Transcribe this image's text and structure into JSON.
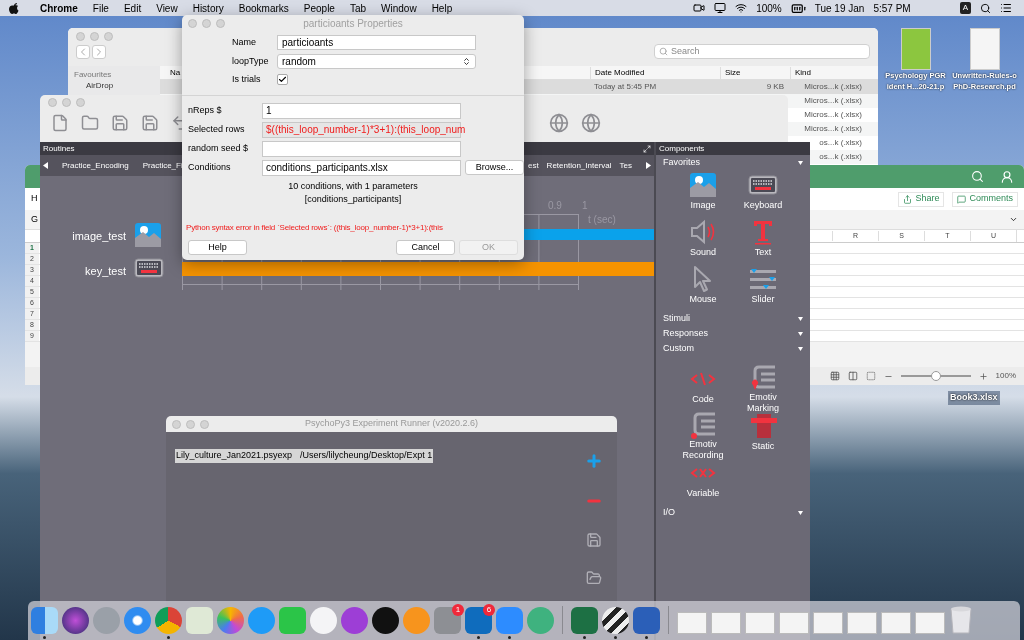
{
  "menubar": {
    "app": "Chrome",
    "items": [
      "File",
      "Edit",
      "View",
      "History",
      "Bookmarks",
      "People",
      "Tab",
      "Window",
      "Help"
    ],
    "battery": "100%",
    "date": "Tue 19 Jan",
    "time": "5:57 PM",
    "input_source": "A"
  },
  "desktop_icons": [
    {
      "lines": [
        "Psychology PGR",
        "ident H...20-21.p"
      ]
    },
    {
      "lines": [
        "Unwritten-Rules-o",
        "PhD-Research.pd"
      ]
    }
  ],
  "desktop_file_label": "Book3.xlsx",
  "finder": {
    "search_placeholder": "Search",
    "sidebar_heading": "Favourites",
    "sidebar_items": [
      "AirDrop"
    ],
    "columns": [
      "Na",
      "Date Modified",
      "Size",
      "Kind"
    ],
    "rows": [
      {
        "date": "Today at 5:45 PM",
        "size": "9 KB",
        "kind": "Micros...k (.xlsx)",
        "selected": true
      },
      {
        "kind": "Micros...k (.xlsx)",
        "selected": false
      },
      {
        "kind": "Micros...k (.xlsx)",
        "selected": false
      },
      {
        "kind": "Micros...k (.xlsx)",
        "selected": false
      },
      {
        "kind": "os...k (.xlsx)",
        "selected": false
      },
      {
        "kind": "os...k (.xlsx)",
        "selected": false
      }
    ]
  },
  "excel": {
    "ribbon_tab": "H",
    "name_box": "G",
    "buttons": [
      "Share",
      "Comments"
    ],
    "columns": [
      "R",
      "S",
      "T",
      "U"
    ],
    "rows": [
      {
        "label": "1",
        "selected": true
      },
      {
        "label": "2",
        "selected": false
      },
      {
        "label": "3",
        "selected": false
      },
      {
        "label": "4",
        "selected": false
      },
      {
        "label": "5",
        "selected": false
      },
      {
        "label": "6",
        "selected": false
      },
      {
        "label": "7",
        "selected": false
      },
      {
        "label": "8",
        "selected": false
      },
      {
        "label": "9",
        "selected": false
      }
    ],
    "zoom": "100%",
    "zoom_slider": {
      "level": 0.5
    }
  },
  "builder": {
    "routines_title": "Routines",
    "routine_tabs_left": [
      "Practice_Encoding",
      "Practice_Fi"
    ],
    "routine_tabs_right": [
      "est",
      "Retention_Interval",
      "Tes"
    ],
    "timeline": {
      "ticks": [
        "0.9",
        "1"
      ],
      "axis_label": "t (sec)",
      "components": [
        {
          "name": "image_test",
          "kind": "image",
          "color": "#0aa2eb"
        },
        {
          "name": "key_test",
          "kind": "keyboard",
          "color": "#f59300"
        }
      ]
    },
    "components_panel": {
      "title": "Components",
      "sections": [
        {
          "label": "Favorites",
          "items": [
            {
              "label": "Image",
              "kind": "image"
            },
            {
              "label": "Keyboard",
              "kind": "keyboard"
            },
            {
              "label": "Sound",
              "kind": "sound"
            },
            {
              "label": "Text",
              "kind": "text"
            },
            {
              "label": "Mouse",
              "kind": "mouse"
            },
            {
              "label": "Slider",
              "kind": "slider"
            }
          ]
        },
        {
          "label": "Stimuli"
        },
        {
          "label": "Responses"
        },
        {
          "label": "Custom",
          "items": [
            {
              "label": "Code",
              "kind": "code"
            },
            {
              "label": "Emotiv Marking",
              "kind": "emotiv_marking"
            },
            {
              "label": "Emotiv Recording",
              "kind": "emotiv_recording"
            },
            {
              "label": "Static",
              "kind": "static"
            },
            {
              "label": "Variable",
              "kind": "variable"
            }
          ]
        },
        {
          "label": "I/O"
        }
      ]
    }
  },
  "runner": {
    "title": "PsychoPy3 Experiment Runner (v2020.2.6)",
    "experiments": [
      {
        "file": "Lily_culture_Jan2021.psyexp",
        "path": "/Users/lilycheung/Desktop/Expt 1",
        "selected": true
      }
    ]
  },
  "dialog": {
    "title": "particioants Properties",
    "name": {
      "label": "Name",
      "value": "particioants"
    },
    "loop_type": {
      "label": "loopType",
      "value": "random"
    },
    "is_trials": {
      "label": "Is trials",
      "checked": true
    },
    "fields": [
      {
        "label": "nReps $",
        "value": "1",
        "error": false
      },
      {
        "label": "Selected rows",
        "value": "$((this_loop_number-1)*3+1):(this_loop_num",
        "error": true
      },
      {
        "label": "random seed $",
        "error": false
      },
      {
        "label": "Conditions",
        "value": "conditions_participants.xlsx",
        "error": false,
        "button": "Browse..."
      }
    ],
    "info": [
      "10 conditions, with 1 parameters",
      "[conditions_participants]"
    ],
    "error": "Python syntax error in field `Selected rows`:  ((this_loop_number-1)*3+1):(this",
    "buttons": [
      {
        "label": "Help",
        "disabled": false
      },
      {
        "label": "Cancel",
        "disabled": false
      },
      {
        "label": "OK",
        "disabled": true
      }
    ]
  },
  "dock": {
    "items": [
      {
        "kind": "finder",
        "running": true
      },
      {
        "kind": "siri",
        "running": false
      },
      {
        "kind": "launchpad",
        "running": false
      },
      {
        "kind": "safari",
        "running": false
      },
      {
        "kind": "chrome",
        "running": true
      },
      {
        "kind": "maps",
        "running": false
      },
      {
        "kind": "photos",
        "running": false
      },
      {
        "kind": "messages",
        "running": false
      },
      {
        "kind": "facetime",
        "running": false
      },
      {
        "kind": "music",
        "running": false
      },
      {
        "kind": "podcasts",
        "running": false
      },
      {
        "kind": "tv",
        "running": false
      },
      {
        "kind": "books",
        "running": false
      },
      {
        "kind": "settings",
        "running": false,
        "badge": "1"
      },
      {
        "kind": "outlook",
        "running": true,
        "badge": "6"
      },
      {
        "kind": "zoom",
        "running": true
      },
      {
        "kind": "atom",
        "running": false
      },
      {
        "kind": "separator",
        "running": false
      },
      {
        "kind": "excel",
        "running": true
      },
      {
        "kind": "stripes",
        "running": true
      },
      {
        "kind": "word",
        "running": true
      },
      {
        "kind": "separator",
        "running": false
      },
      {
        "kind": "thumbnail",
        "running": false
      },
      {
        "kind": "thumbnail",
        "running": false
      },
      {
        "kind": "thumbnail",
        "running": false
      },
      {
        "kind": "thumbnail",
        "running": false
      },
      {
        "kind": "thumbnail",
        "running": false
      },
      {
        "kind": "thumbnail",
        "running": false
      },
      {
        "kind": "thumbnail",
        "running": false
      },
      {
        "kind": "thumbnail",
        "running": false
      },
      {
        "kind": "trash",
        "running": false
      }
    ]
  }
}
